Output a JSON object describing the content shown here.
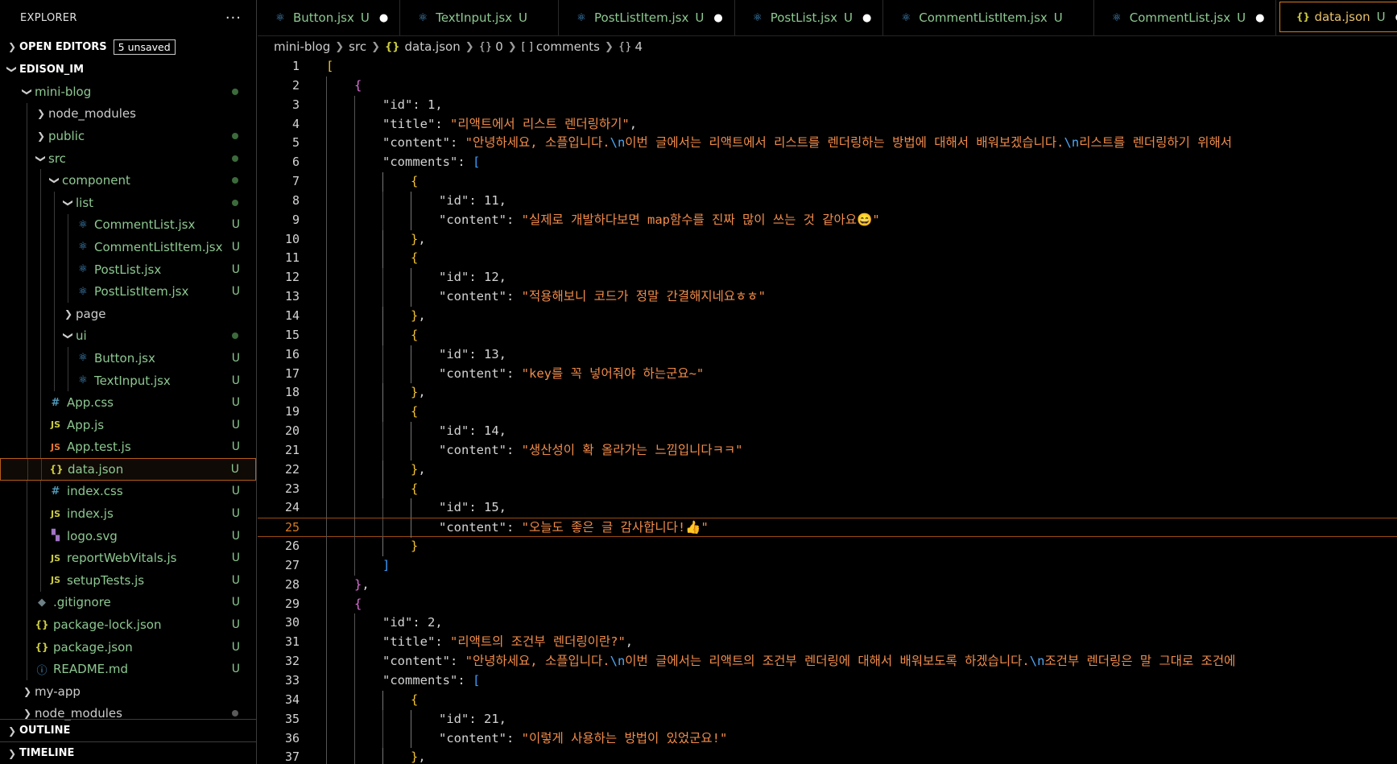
{
  "explorer": {
    "title": "EXPLORER",
    "more": "···",
    "open_editors": "OPEN EDITORS",
    "unsaved": "5 unsaved",
    "root": "EDISON_IM",
    "outline": "OUTLINE",
    "timeline": "TIMELINE",
    "tree": [
      {
        "label": "mini-blog",
        "depth": 1,
        "kind": "folder-open",
        "status": "dot"
      },
      {
        "label": "node_modules",
        "depth": 2,
        "kind": "folder",
        "status": ""
      },
      {
        "label": "public",
        "depth": 2,
        "kind": "folder",
        "status": "dot"
      },
      {
        "label": "src",
        "depth": 2,
        "kind": "folder-open",
        "status": "dot"
      },
      {
        "label": "component",
        "depth": 3,
        "kind": "folder-open",
        "status": "dot"
      },
      {
        "label": "list",
        "depth": 4,
        "kind": "folder-open",
        "status": "dot"
      },
      {
        "label": "CommentList.jsx",
        "depth": 5,
        "kind": "react",
        "status": "U"
      },
      {
        "label": "CommentListItem.jsx",
        "depth": 5,
        "kind": "react",
        "status": "U"
      },
      {
        "label": "PostList.jsx",
        "depth": 5,
        "kind": "react",
        "status": "U"
      },
      {
        "label": "PostListItem.jsx",
        "depth": 5,
        "kind": "react",
        "status": "U"
      },
      {
        "label": "page",
        "depth": 4,
        "kind": "folder",
        "status": ""
      },
      {
        "label": "ui",
        "depth": 4,
        "kind": "folder-open",
        "status": "dot"
      },
      {
        "label": "Button.jsx",
        "depth": 5,
        "kind": "react",
        "status": "U"
      },
      {
        "label": "TextInput.jsx",
        "depth": 5,
        "kind": "react",
        "status": "U"
      },
      {
        "label": "App.css",
        "depth": 3,
        "kind": "css",
        "status": "U"
      },
      {
        "label": "App.js",
        "depth": 3,
        "kind": "js",
        "status": "U"
      },
      {
        "label": "App.test.js",
        "depth": 3,
        "kind": "test",
        "status": "U"
      },
      {
        "label": "data.json",
        "depth": 3,
        "kind": "json",
        "status": "U",
        "selected": true
      },
      {
        "label": "index.css",
        "depth": 3,
        "kind": "css",
        "status": "U"
      },
      {
        "label": "index.js",
        "depth": 3,
        "kind": "js",
        "status": "U"
      },
      {
        "label": "logo.svg",
        "depth": 3,
        "kind": "svg",
        "status": "U"
      },
      {
        "label": "reportWebVitals.js",
        "depth": 3,
        "kind": "js",
        "status": "U"
      },
      {
        "label": "setupTests.js",
        "depth": 3,
        "kind": "js",
        "status": "U"
      },
      {
        "label": ".gitignore",
        "depth": 2,
        "kind": "git",
        "status": "U"
      },
      {
        "label": "package-lock.json",
        "depth": 2,
        "kind": "json",
        "status": "U"
      },
      {
        "label": "package.json",
        "depth": 2,
        "kind": "json",
        "status": "U"
      },
      {
        "label": "README.md",
        "depth": 2,
        "kind": "info",
        "status": "U"
      },
      {
        "label": "my-app",
        "depth": 1,
        "kind": "folder",
        "status": ""
      },
      {
        "label": "node_modules",
        "depth": 1,
        "kind": "folder",
        "status": "greydot"
      }
    ]
  },
  "tabs": [
    {
      "label": "Button.jsx",
      "icon": "react",
      "u": "U",
      "dirty": true,
      "active": false
    },
    {
      "label": "TextInput.jsx",
      "icon": "react",
      "u": "U",
      "dirty": false,
      "active": false
    },
    {
      "label": "PostListItem.jsx",
      "icon": "react",
      "u": "U",
      "dirty": true,
      "active": false
    },
    {
      "label": "PostList.jsx",
      "icon": "react",
      "u": "U",
      "dirty": true,
      "active": false
    },
    {
      "label": "CommentListItem.jsx",
      "icon": "react",
      "u": "U",
      "dirty": false,
      "active": false
    },
    {
      "label": "CommentList.jsx",
      "icon": "react",
      "u": "U",
      "dirty": true,
      "active": false
    },
    {
      "label": "data.json",
      "icon": "json",
      "u": "U",
      "dirty": true,
      "active": true
    }
  ],
  "breadcrumb": [
    "mini-blog",
    "src",
    "data.json",
    "0",
    "comments",
    "4"
  ],
  "editor": {
    "current_line": 25,
    "lines": [
      {
        "n": 1,
        "i": 0,
        "t": [
          [
            "b1",
            "["
          ]
        ]
      },
      {
        "n": 2,
        "i": 1,
        "t": [
          [
            "b2",
            "{"
          ]
        ]
      },
      {
        "n": 3,
        "i": 2,
        "t": [
          [
            "k",
            "\"id\""
          ],
          [
            "p",
            ": "
          ],
          [
            "n",
            "1"
          ],
          [
            "p",
            ","
          ]
        ]
      },
      {
        "n": 4,
        "i": 2,
        "t": [
          [
            "k",
            "\"title\""
          ],
          [
            "p",
            ": "
          ],
          [
            "s",
            "\"리액트에서 리스트 렌더링하기\""
          ],
          [
            "p",
            ","
          ]
        ]
      },
      {
        "n": 5,
        "i": 2,
        "t": [
          [
            "k",
            "\"content\""
          ],
          [
            "p",
            ": "
          ],
          [
            "s",
            "\"안녕하세요, 소플입니다."
          ],
          [
            "esc",
            "\\n"
          ],
          [
            "s",
            "이번 글에서는 리액트에서 리스트를 렌더링하는 방법에 대해서 배워보겠습니다."
          ],
          [
            "esc",
            "\\n"
          ],
          [
            "s",
            "리스트를 렌더링하기 위해서"
          ]
        ]
      },
      {
        "n": 6,
        "i": 2,
        "t": [
          [
            "k",
            "\"comments\""
          ],
          [
            "p",
            ": "
          ],
          [
            "b3",
            "["
          ]
        ]
      },
      {
        "n": 7,
        "i": 3,
        "t": [
          [
            "b1",
            "{"
          ]
        ]
      },
      {
        "n": 8,
        "i": 4,
        "t": [
          [
            "k",
            "\"id\""
          ],
          [
            "p",
            ": "
          ],
          [
            "n",
            "11"
          ],
          [
            "p",
            ","
          ]
        ]
      },
      {
        "n": 9,
        "i": 4,
        "t": [
          [
            "k",
            "\"content\""
          ],
          [
            "p",
            ": "
          ],
          [
            "s",
            "\"실제로 개발하다보면 map함수를 진짜 많이 쓰는 것 같아요😄\""
          ]
        ]
      },
      {
        "n": 10,
        "i": 3,
        "t": [
          [
            "b1",
            "}"
          ],
          [
            "p",
            ","
          ]
        ]
      },
      {
        "n": 11,
        "i": 3,
        "t": [
          [
            "b1",
            "{"
          ]
        ]
      },
      {
        "n": 12,
        "i": 4,
        "t": [
          [
            "k",
            "\"id\""
          ],
          [
            "p",
            ": "
          ],
          [
            "n",
            "12"
          ],
          [
            "p",
            ","
          ]
        ]
      },
      {
        "n": 13,
        "i": 4,
        "t": [
          [
            "k",
            "\"content\""
          ],
          [
            "p",
            ": "
          ],
          [
            "s",
            "\"적용해보니 코드가 정말 간결해지네요ㅎㅎ\""
          ]
        ]
      },
      {
        "n": 14,
        "i": 3,
        "t": [
          [
            "b1",
            "}"
          ],
          [
            "p",
            ","
          ]
        ]
      },
      {
        "n": 15,
        "i": 3,
        "t": [
          [
            "b1",
            "{"
          ]
        ]
      },
      {
        "n": 16,
        "i": 4,
        "t": [
          [
            "k",
            "\"id\""
          ],
          [
            "p",
            ": "
          ],
          [
            "n",
            "13"
          ],
          [
            "p",
            ","
          ]
        ]
      },
      {
        "n": 17,
        "i": 4,
        "t": [
          [
            "k",
            "\"content\""
          ],
          [
            "p",
            ": "
          ],
          [
            "s",
            "\"key를 꼭 넣어줘야 하는군요~\""
          ]
        ]
      },
      {
        "n": 18,
        "i": 3,
        "t": [
          [
            "b1",
            "}"
          ],
          [
            "p",
            ","
          ]
        ]
      },
      {
        "n": 19,
        "i": 3,
        "t": [
          [
            "b1",
            "{"
          ]
        ]
      },
      {
        "n": 20,
        "i": 4,
        "t": [
          [
            "k",
            "\"id\""
          ],
          [
            "p",
            ": "
          ],
          [
            "n",
            "14"
          ],
          [
            "p",
            ","
          ]
        ]
      },
      {
        "n": 21,
        "i": 4,
        "t": [
          [
            "k",
            "\"content\""
          ],
          [
            "p",
            ": "
          ],
          [
            "s",
            "\"생산성이 확 올라가는 느낌입니다ㅋㅋ\""
          ]
        ]
      },
      {
        "n": 22,
        "i": 3,
        "t": [
          [
            "b1",
            "}"
          ],
          [
            "p",
            ","
          ]
        ]
      },
      {
        "n": 23,
        "i": 3,
        "t": [
          [
            "b1",
            "{"
          ]
        ]
      },
      {
        "n": 24,
        "i": 4,
        "t": [
          [
            "k",
            "\"id\""
          ],
          [
            "p",
            ": "
          ],
          [
            "n",
            "15"
          ],
          [
            "p",
            ","
          ]
        ]
      },
      {
        "n": 25,
        "i": 4,
        "t": [
          [
            "k",
            "\"content\""
          ],
          [
            "p",
            ": "
          ],
          [
            "s",
            "\"오늘도 좋은 글 감사합니다!👍\""
          ]
        ]
      },
      {
        "n": 26,
        "i": 3,
        "t": [
          [
            "b1",
            "}"
          ]
        ]
      },
      {
        "n": 27,
        "i": 2,
        "t": [
          [
            "b3",
            "]"
          ]
        ]
      },
      {
        "n": 28,
        "i": 1,
        "t": [
          [
            "b2",
            "}"
          ],
          [
            "p",
            ","
          ]
        ]
      },
      {
        "n": 29,
        "i": 1,
        "t": [
          [
            "b2",
            "{"
          ]
        ]
      },
      {
        "n": 30,
        "i": 2,
        "t": [
          [
            "k",
            "\"id\""
          ],
          [
            "p",
            ": "
          ],
          [
            "n",
            "2"
          ],
          [
            "p",
            ","
          ]
        ]
      },
      {
        "n": 31,
        "i": 2,
        "t": [
          [
            "k",
            "\"title\""
          ],
          [
            "p",
            ": "
          ],
          [
            "s",
            "\"리액트의 조건부 렌더링이란?\""
          ],
          [
            "p",
            ","
          ]
        ]
      },
      {
        "n": 32,
        "i": 2,
        "t": [
          [
            "k",
            "\"content\""
          ],
          [
            "p",
            ": "
          ],
          [
            "s",
            "\"안녕하세요, 소플입니다."
          ],
          [
            "esc",
            "\\n"
          ],
          [
            "s",
            "이번 글에서는 리액트의 조건부 렌더링에 대해서 배워보도록 하겠습니다."
          ],
          [
            "esc",
            "\\n"
          ],
          [
            "s",
            "조건부 렌더링은 말 그대로 조건에"
          ]
        ]
      },
      {
        "n": 33,
        "i": 2,
        "t": [
          [
            "k",
            "\"comments\""
          ],
          [
            "p",
            ": "
          ],
          [
            "b3",
            "["
          ]
        ]
      },
      {
        "n": 34,
        "i": 3,
        "t": [
          [
            "b1",
            "{"
          ]
        ]
      },
      {
        "n": 35,
        "i": 4,
        "t": [
          [
            "k",
            "\"id\""
          ],
          [
            "p",
            ": "
          ],
          [
            "n",
            "21"
          ],
          [
            "p",
            ","
          ]
        ]
      },
      {
        "n": 36,
        "i": 4,
        "t": [
          [
            "k",
            "\"content\""
          ],
          [
            "p",
            ": "
          ],
          [
            "s",
            "\"이렇게 사용하는 방법이 있었군요!\""
          ]
        ]
      },
      {
        "n": 37,
        "i": 3,
        "t": [
          [
            "b1",
            "}"
          ],
          [
            "p",
            ","
          ]
        ]
      }
    ]
  },
  "colors": {
    "accent": "#d97a1e",
    "untracked": "#8dc891",
    "string": "#f28c4a",
    "escape": "#4fa6f5"
  }
}
